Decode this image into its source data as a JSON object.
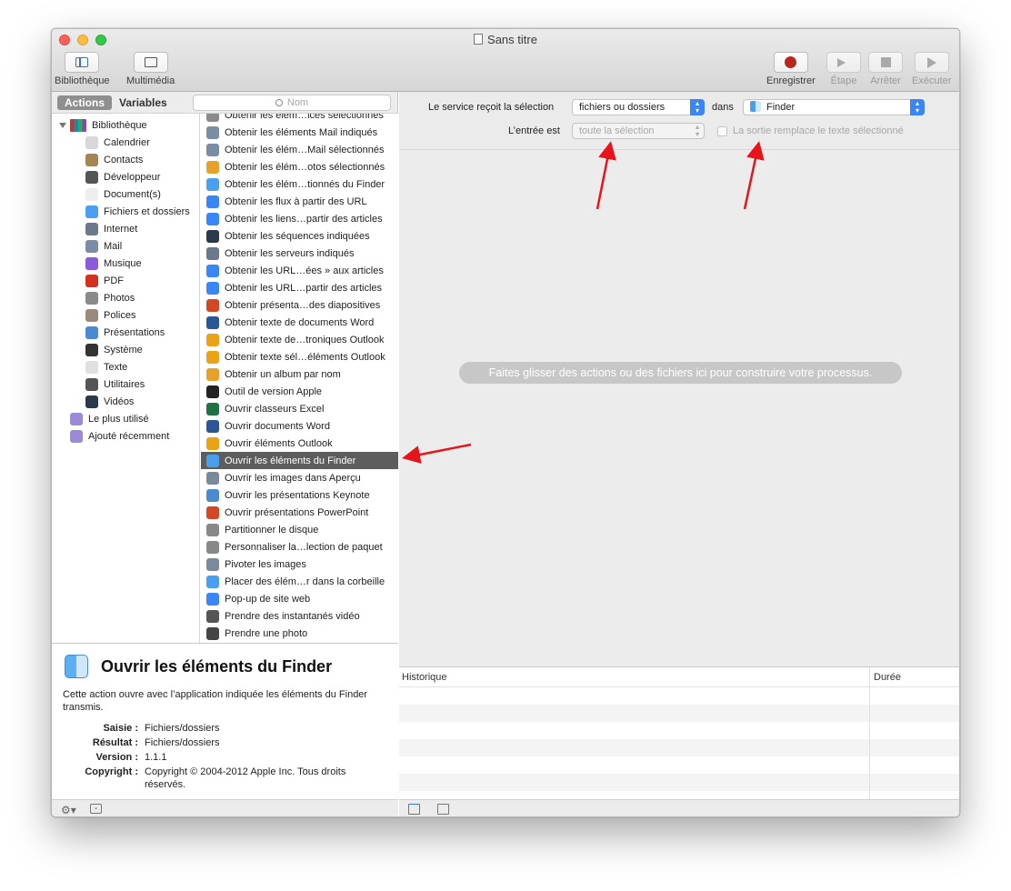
{
  "window": {
    "title": "Sans titre"
  },
  "toolbar": {
    "library_label": "Bibliothèque",
    "media_label": "Multimédia",
    "record_label": "Enregistrer",
    "step_label": "Étape",
    "stop_label": "Arrêter",
    "run_label": "Exécuter"
  },
  "left": {
    "tab_actions": "Actions",
    "tab_variables": "Variables",
    "search_placeholder": "Nom",
    "library_root": "Bibliothèque",
    "library_items": [
      {
        "label": "Calendrier",
        "icon": "calendar-icon",
        "color": "#d8d8d8"
      },
      {
        "label": "Contacts",
        "icon": "contacts-icon",
        "color": "#a58551"
      },
      {
        "label": "Développeur",
        "icon": "developer-icon",
        "color": "#555555"
      },
      {
        "label": "Document(s)",
        "icon": "document-icon",
        "color": "#eeeeee"
      },
      {
        "label": "Fichiers et dossiers",
        "icon": "finder-icon",
        "color": "#4aa0ee"
      },
      {
        "label": "Internet",
        "icon": "internet-icon",
        "color": "#6b7a8a"
      },
      {
        "label": "Mail",
        "icon": "mail-icon",
        "color": "#7a8ea3"
      },
      {
        "label": "Musique",
        "icon": "music-icon",
        "color": "#8a5ad9"
      },
      {
        "label": "PDF",
        "icon": "pdf-icon",
        "color": "#d2321f"
      },
      {
        "label": "Photos",
        "icon": "photos-icon",
        "color": "#8a8a8a"
      },
      {
        "label": "Polices",
        "icon": "fonts-icon",
        "color": "#9a8a7a"
      },
      {
        "label": "Présentations",
        "icon": "presentation-icon",
        "color": "#4a8ad0"
      },
      {
        "label": "Système",
        "icon": "system-icon",
        "color": "#333333"
      },
      {
        "label": "Texte",
        "icon": "text-icon",
        "color": "#e0e0e0"
      },
      {
        "label": "Utilitaires",
        "icon": "utilities-icon",
        "color": "#555555"
      },
      {
        "label": "Vidéos",
        "icon": "video-icon",
        "color": "#2a3a4a"
      }
    ],
    "groups": [
      {
        "label": "Le plus utilisé",
        "icon": "smart-folder-icon"
      },
      {
        "label": "Ajouté récemment",
        "icon": "smart-folder-icon"
      }
    ],
    "actions": [
      {
        "label": "Obtenir les élém…ices sélectionnés",
        "icon": "contacts-icon",
        "color": "#8a8a8a"
      },
      {
        "label": "Obtenir les éléments Mail indiqués",
        "icon": "mail-icon",
        "color": "#7a8ea3"
      },
      {
        "label": "Obtenir les élém…Mail sélectionnés",
        "icon": "mail-icon",
        "color": "#7a8ea3"
      },
      {
        "label": "Obtenir les élém…otos sélectionnés",
        "icon": "photos-icon",
        "color": "#e6a12a"
      },
      {
        "label": "Obtenir les élém…tionnés du Finder",
        "icon": "finder-icon",
        "color": "#4aa0ee"
      },
      {
        "label": "Obtenir les flux à partir des URL",
        "icon": "safari-icon",
        "color": "#3a86f7"
      },
      {
        "label": "Obtenir les liens…partir des articles",
        "icon": "safari-icon",
        "color": "#3a86f7"
      },
      {
        "label": "Obtenir les séquences indiquées",
        "icon": "quicktime-icon",
        "color": "#2a3a4a"
      },
      {
        "label": "Obtenir les serveurs indiqués",
        "icon": "internet-icon",
        "color": "#6b7a8a"
      },
      {
        "label": "Obtenir les URL…ées » aux articles",
        "icon": "safari-icon",
        "color": "#3a86f7"
      },
      {
        "label": "Obtenir les URL…partir des articles",
        "icon": "safari-icon",
        "color": "#3a86f7"
      },
      {
        "label": "Obtenir présenta…des diapositives",
        "icon": "powerpoint-icon",
        "color": "#d24726"
      },
      {
        "label": "Obtenir texte de documents Word",
        "icon": "word-icon",
        "color": "#2b5797"
      },
      {
        "label": "Obtenir texte de…troniques Outlook",
        "icon": "outlook-icon",
        "color": "#e8a317"
      },
      {
        "label": "Obtenir texte sél…éléments Outlook",
        "icon": "outlook-icon",
        "color": "#e8a317"
      },
      {
        "label": "Obtenir un album par nom",
        "icon": "photos-icon",
        "color": "#e6a12a"
      },
      {
        "label": "Outil de version Apple",
        "icon": "terminal-icon",
        "color": "#222222"
      },
      {
        "label": "Ouvrir classeurs Excel",
        "icon": "excel-icon",
        "color": "#207245"
      },
      {
        "label": "Ouvrir documents Word",
        "icon": "word-icon",
        "color": "#2b5797"
      },
      {
        "label": "Ouvrir éléments Outlook",
        "icon": "outlook-icon",
        "color": "#e8a317"
      },
      {
        "label": "Ouvrir les éléments du Finder",
        "icon": "finder-icon",
        "color": "#4aa0ee"
      },
      {
        "label": "Ouvrir les images dans Aperçu",
        "icon": "preview-icon",
        "color": "#7a8a9a"
      },
      {
        "label": "Ouvrir les présentations Keynote",
        "icon": "keynote-icon",
        "color": "#4a8ad0"
      },
      {
        "label": "Ouvrir présentations PowerPoint",
        "icon": "powerpoint-icon",
        "color": "#d24726"
      },
      {
        "label": "Partitionner le disque",
        "icon": "disk-utility-icon",
        "color": "#888888"
      },
      {
        "label": "Personnaliser la…lection de paquet",
        "icon": "installer-icon",
        "color": "#888888"
      },
      {
        "label": "Pivoter les images",
        "icon": "preview-icon",
        "color": "#7a8a9a"
      },
      {
        "label": "Placer des élém…r dans la corbeille",
        "icon": "finder-icon",
        "color": "#4aa0ee"
      },
      {
        "label": "Pop-up de site web",
        "icon": "safari-icon",
        "color": "#3a86f7"
      },
      {
        "label": "Prendre des instantanés vidéo",
        "icon": "utilities-icon",
        "color": "#555555"
      },
      {
        "label": "Prendre une photo",
        "icon": "camera-icon",
        "color": "#444444"
      }
    ],
    "selected_action": "Ouvrir les éléments du Finder",
    "description": {
      "title": "Ouvrir les éléments du Finder",
      "text": "Cette action ouvre avec l’application indiquée les éléments du Finder transmis.",
      "meta": [
        {
          "key": "Saisie :",
          "value": "Fichiers/dossiers"
        },
        {
          "key": "Résultat :",
          "value": "Fichiers/dossiers"
        },
        {
          "key": "Version :",
          "value": "1.1.1"
        },
        {
          "key": "Copyright :",
          "value": "Copyright © 2004-2012 Apple Inc. Tous droits réservés."
        }
      ]
    }
  },
  "workflow": {
    "receives_label": "Le service reçoit la sélection",
    "receives_value": "fichiers ou dossiers",
    "in_label": "dans",
    "in_value": "Finder",
    "input_is_label": "L’entrée est",
    "input_is_value": "toute la sélection",
    "replaces_label": "La sortie remplace le texte sélectionné",
    "drop_hint": "Faites glisser des actions ou des fichiers ici pour construire votre processus.",
    "log_header_history": "Historique",
    "log_header_duration": "Durée"
  },
  "colors": {
    "annotation_arrow": "#e8141a",
    "selection": "#5d5d5d",
    "accent": "#3a86f7"
  }
}
